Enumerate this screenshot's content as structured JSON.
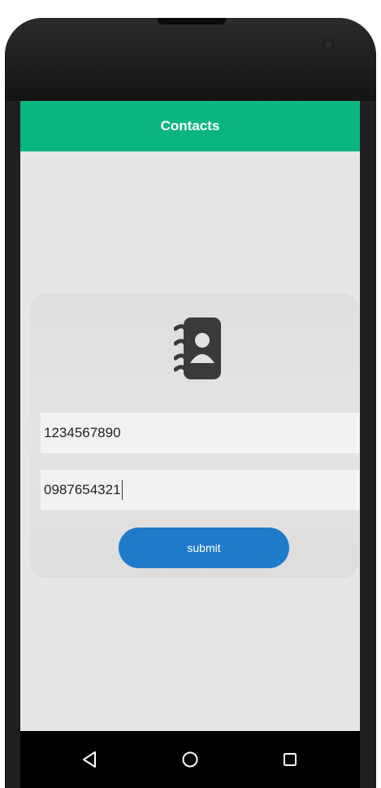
{
  "app": {
    "title": "Contacts"
  },
  "form": {
    "field_1_value": "1234567890",
    "field_2_value": "0987654321",
    "submit_label": "submit"
  },
  "icons": {
    "header_icon": "contact-book-icon",
    "nav_back": "back-triangle-icon",
    "nav_home": "home-circle-icon",
    "nav_recent": "recent-apps-square-icon"
  },
  "colors": {
    "app_bar": "#0bb582",
    "button": "#1f7bc9",
    "background": "#e6e6e6",
    "icon": "#3a3a3a"
  }
}
